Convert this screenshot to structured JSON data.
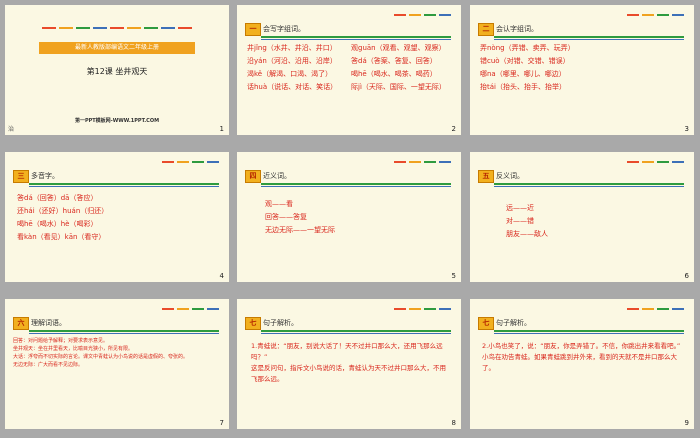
{
  "colors": {
    "badge": "#f2b01e",
    "green": "#2e9b3f",
    "blue": "#3d70b8",
    "red": "#d9261c"
  },
  "slides": [
    {
      "num": "1",
      "cover_bar": "最新人教版部编语文二年级上册",
      "title": "第12课 坐井观天",
      "site": "第一PPT模板网-WWW.1PPT.COM",
      "left_note": "治"
    },
    {
      "num": "2",
      "badge": "一",
      "heading": "会写字组词。",
      "left": [
        "井jǐng（水井、井沿、井口）",
        "沿yán（河沿、沿用、沿岸）",
        "渴kě（解渴、口渴、渴了）",
        "话huà（说话、对话、笑话）"
      ],
      "right": [
        "观guān（观看、观望、观察）",
        "答dá（答案、答复、回答）",
        "喝hē（喝水、喝茶、喝药）",
        "际jì（天际、国际、一望无际）"
      ]
    },
    {
      "num": "3",
      "badge": "二",
      "heading": "会认字组词。",
      "lines": [
        "弄nòng（弄错、卖弄、玩弄）",
        "错cuò（对错、交错、错误）",
        "哪na（哪里、哪儿、哪边）",
        "抬tái（抬头、抬手、抬举）"
      ]
    },
    {
      "num": "4",
      "badge": "三",
      "heading": "多音字。",
      "lines": [
        "答dá（回答）dā（答应）",
        "还hái（还好）huán（归还）",
        "喝hē（喝水）hè（喝彩）",
        "看kàn（看见）kān（看守）"
      ]
    },
    {
      "num": "5",
      "badge": "四",
      "heading": "近义词。",
      "lines": [
        "观——看",
        "回答——答复",
        "无边无际——一望无际"
      ]
    },
    {
      "num": "6",
      "badge": "五",
      "heading": "反义词。",
      "lines": [
        "远——近",
        "对——错",
        "朋友——敌人"
      ]
    },
    {
      "num": "7",
      "badge": "六",
      "heading": "理解词语。",
      "lines": [
        "回答：对问题给予解释；对要求表示意见。",
        "坐井观天：坐在井里看天，比喻目光狭小，所见有限。",
        "大话：浮夸而不切实际的言论。课文中青蛙认为小鸟说的话是虚假的、夸张的。",
        "无边无际：广大而看不见边际。"
      ]
    },
    {
      "num": "8",
      "badge": "七",
      "heading": "句子解析。",
      "lines": [
        "1.青蛙说：“朋友，别说大话了！天不过井口那么大，还用飞那么远吗？”",
        "这是反问句，指斥文小鸟说的话，青蛙认为天不过井口那么大，不用飞那么远。"
      ]
    },
    {
      "num": "9",
      "badge": "七",
      "heading": "句子解析。",
      "lines": [
        "2.小鸟也笑了，说：“朋友，你是弄错了。不信，你跳出井来看看吧。”",
        "小鸟在劝告青蛙。如果青蛙跳到井外来，看到的天就不是井口那么大了。"
      ]
    }
  ]
}
